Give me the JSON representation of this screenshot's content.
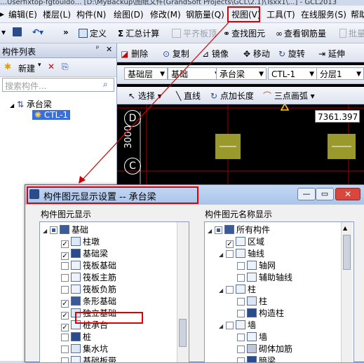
{
  "window_title": "…Userfixtop-fgtouldo… [D:\\MyBackup\\图纸文件(GrandSoft Projects\\GCL\\2.1)\\Tsxx1\\...] - GCL2013",
  "menu": [
    "编辑(E)",
    "楼层(L)",
    "构件(N)",
    "绘图(D)",
    "修改(M)",
    "钢筋量(Q)",
    "视图(V)",
    "工具(T)",
    "在线服务(S)",
    "帮助"
  ],
  "toolbar": {
    "define": "定义",
    "sum_calc": "汇总计算",
    "flat_top": "平齐板顶",
    "find_element": "查找图元",
    "view_rebar": "查看钢筋量",
    "batch": "批量"
  },
  "left_panel": {
    "title": "构件列表",
    "pin": "ᵖ",
    "close": "✕",
    "new_button": "新建",
    "search_placeholder": "搜索构件...",
    "tree_root": "承台梁",
    "tree_child": "CTL-1"
  },
  "edit_toolbar": {
    "delete": "删除",
    "copy": "复制",
    "mirror": "镜像",
    "move": "移动",
    "rotate": "旋转",
    "extend": "延伸"
  },
  "selectors": {
    "floor": "基础层",
    "category": "基础",
    "type": "承台梁",
    "element": "CTL-1",
    "layer": "分层1"
  },
  "draw_toolbar": {
    "select": "选择",
    "line": "直线",
    "point_length": "点加长度",
    "three_point_arc": "三点画弧"
  },
  "canvas": {
    "axis_d": "D",
    "axis_c": "C",
    "dim_3000": "3000",
    "coord_readout": "7361.397"
  },
  "dialog": {
    "title": "构件图元显示设置 -- 承台梁",
    "left_header": "构件图元显示",
    "right_header": "构件图元名称显示",
    "left_items": [
      {
        "label": "基础",
        "level": 0,
        "check": "tri",
        "expand": "minus"
      },
      {
        "label": "柱墩",
        "level": 1,
        "check": "on"
      },
      {
        "label": "基础梁",
        "level": 1,
        "check": "on"
      },
      {
        "label": "筏板基础",
        "level": 1,
        "check": "off"
      },
      {
        "label": "筏板主筋",
        "level": 1,
        "check": "off"
      },
      {
        "label": "筏板负筋",
        "level": 1,
        "check": "off"
      },
      {
        "label": "条形基础",
        "level": 1,
        "check": "on"
      },
      {
        "label": "独立基础",
        "level": 1,
        "check": "on"
      },
      {
        "label": "桩承台",
        "level": 1,
        "check": "on"
      },
      {
        "label": "桩",
        "level": 1,
        "check": "off"
      },
      {
        "label": "集水坑",
        "level": 1,
        "check": "off"
      },
      {
        "label": "基础板带",
        "level": 1,
        "check": "off"
      }
    ],
    "right_items": [
      {
        "label": "所有构件",
        "level": 0,
        "check": "tri",
        "expand": "minus"
      },
      {
        "label": "区域",
        "level": 1,
        "check": "on"
      },
      {
        "label": "轴线",
        "level": 1,
        "check": "off",
        "expand": "minus"
      },
      {
        "label": "轴网",
        "level": 2,
        "check": "off"
      },
      {
        "label": "辅助轴线",
        "level": 2,
        "check": "off"
      },
      {
        "label": "柱",
        "level": 1,
        "check": "off",
        "expand": "minus"
      },
      {
        "label": "柱",
        "level": 2,
        "check": "off"
      },
      {
        "label": "构造柱",
        "level": 2,
        "check": "off"
      },
      {
        "label": "墙",
        "level": 1,
        "check": "off",
        "expand": "minus"
      },
      {
        "label": "墙",
        "level": 2,
        "check": "off"
      },
      {
        "label": "砌体加筋",
        "level": 2,
        "check": "off"
      },
      {
        "label": "暗梁",
        "level": 2,
        "check": "off"
      }
    ]
  },
  "colors": {
    "highlight_red": "#e00000",
    "canvas_bg": "#000000",
    "grid_red": "#c00000",
    "cap_fill": "#9a9a2c"
  }
}
